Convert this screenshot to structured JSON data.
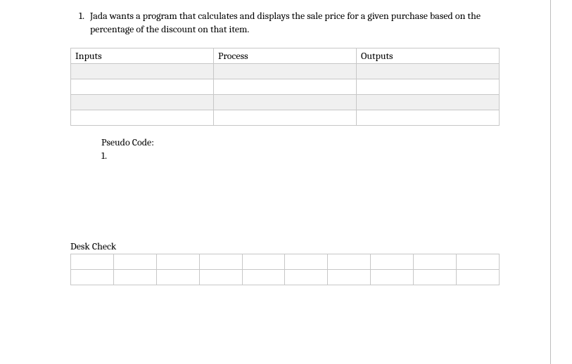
{
  "question": {
    "number": "1.",
    "text": "Jada wants a program that calculates and displays the sale price for a given purchase based on the percentage of the discount on that item."
  },
  "ipo": {
    "headers": [
      "Inputs",
      "Process",
      "Outputs"
    ],
    "rows": [
      [
        "",
        "",
        ""
      ],
      [
        "",
        "",
        ""
      ],
      [
        "",
        "",
        ""
      ],
      [
        "",
        "",
        ""
      ]
    ]
  },
  "pseudo": {
    "title": "Pseudo Code:",
    "line1": "1."
  },
  "deskCheck": {
    "label": "Desk Check",
    "cols": 10,
    "rows": 2
  }
}
